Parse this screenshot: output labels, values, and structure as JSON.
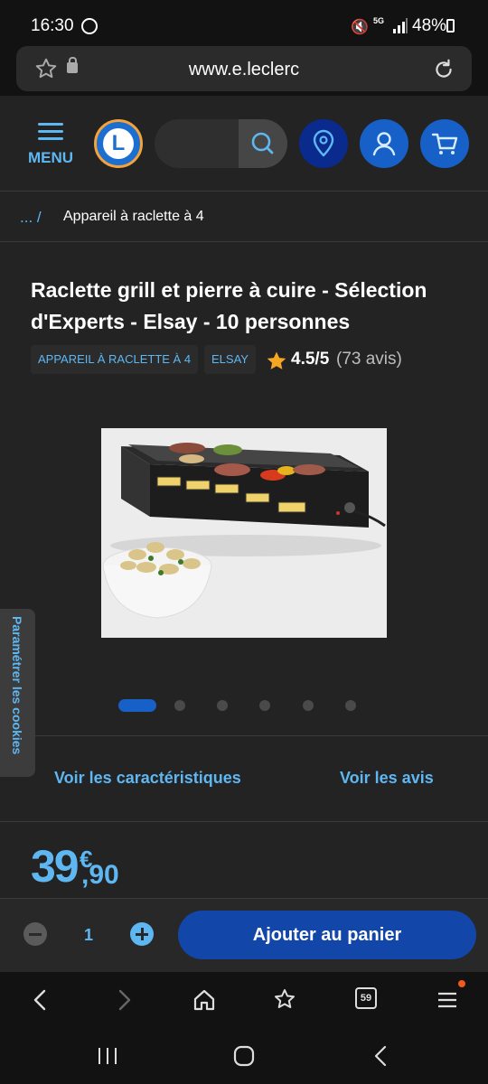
{
  "status_bar": {
    "time": "16:30",
    "network": "5G",
    "battery": "48%"
  },
  "browser": {
    "url": "www.e.leclerc"
  },
  "header": {
    "menu_label": "MENU",
    "logo_letter": "L"
  },
  "breadcrumb": {
    "ellipsis": "... /",
    "current": "Appareil à raclette à 4"
  },
  "product": {
    "title": "Raclette grill et pierre à cuire - Sélection d'Experts - Elsay - 10 personnes",
    "tags": [
      "APPAREIL À RACLETTE À 4",
      "ELSAY"
    ],
    "rating_value": "4.5/5",
    "rating_count": "(73 avis)",
    "carousel": {
      "total": 6,
      "active": 1
    },
    "link_specs": "Voir les caractéristiques",
    "link_reviews": "Voir les avis",
    "price_euros": "39",
    "price_currency": "€",
    "price_cents": ",90"
  },
  "cart_bar": {
    "quantity": "1",
    "add_label": "Ajouter au panier"
  },
  "cookie_tab": {
    "label": "Paramétrer les cookies"
  },
  "browser_nav": {
    "tab_count": "59"
  },
  "colors": {
    "accent": "#5fb7f2",
    "primary_button": "#1246a8",
    "background": "#232323",
    "star": "#f5a623"
  }
}
